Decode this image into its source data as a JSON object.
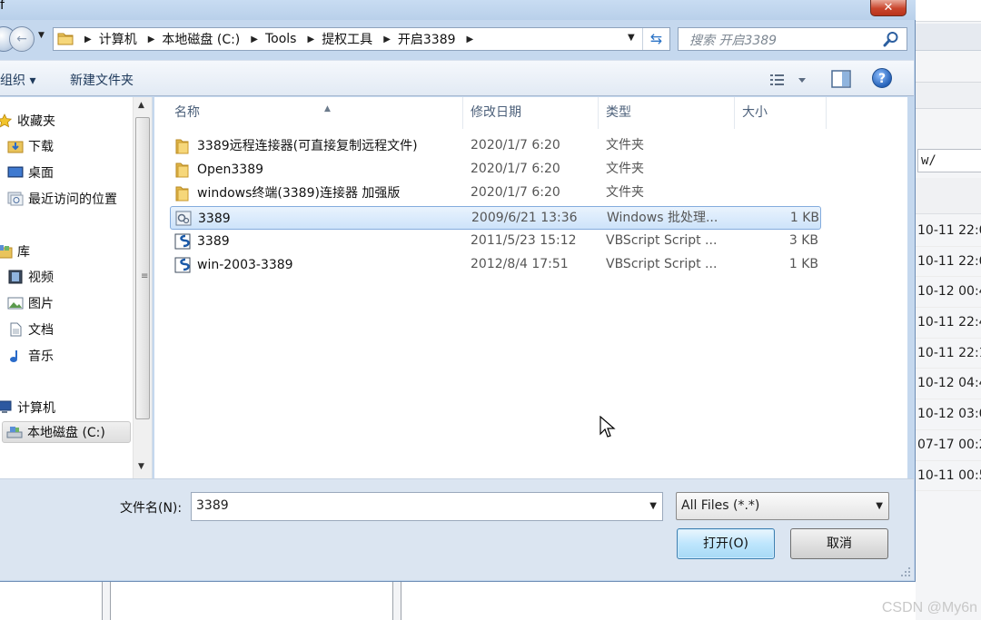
{
  "dialog": {
    "title_fragment": "f",
    "close_label": "✕"
  },
  "address": {
    "breadcrumbs": [
      "计算机",
      "本地磁盘 (C:)",
      "Tools",
      "提权工具",
      "开启3389"
    ]
  },
  "search": {
    "placeholder": "搜索 开启3389"
  },
  "toolbar": {
    "organize_label": "组织 ▾",
    "new_folder_label": "新建文件夹",
    "help_label": "?"
  },
  "navpane": {
    "favorites": "收藏夹",
    "downloads": "下载",
    "desktop": "桌面",
    "recent": "最近访问的位置",
    "libraries": "库",
    "videos": "视频",
    "pictures": "图片",
    "documents": "文档",
    "music": "音乐",
    "computer": "计算机",
    "local_disk": "本地磁盘 (C:)"
  },
  "filelist": {
    "columns": {
      "name": "名称",
      "date": "修改日期",
      "type": "类型",
      "size": "大小"
    },
    "rows": [
      {
        "name": "3389远程连接器(可直接复制远程文件)",
        "date": "2020/1/7 6:20",
        "type": "文件夹",
        "size": "",
        "icon": "folder-icon"
      },
      {
        "name": "Open3389",
        "date": "2020/1/7 6:20",
        "type": "文件夹",
        "size": "",
        "icon": "folder-icon"
      },
      {
        "name": "windows终端(3389)连接器 加强版",
        "date": "2020/1/7 6:20",
        "type": "文件夹",
        "size": "",
        "icon": "folder-icon"
      },
      {
        "name": "3389",
        "date": "2009/6/21 13:36",
        "type": "Windows 批处理...",
        "size": "1 KB",
        "icon": "batch-file-icon"
      },
      {
        "name": "3389",
        "date": "2011/5/23 15:12",
        "type": "VBScript Script ...",
        "size": "3 KB",
        "icon": "vbscript-file-icon"
      },
      {
        "name": "win-2003-3389",
        "date": "2012/8/4 17:51",
        "type": "VBScript Script ...",
        "size": "1 KB",
        "icon": "vbscript-file-icon"
      }
    ]
  },
  "footer": {
    "filename_label": "文件名(N):",
    "filename_value": "3389",
    "filetype_value": "All Files (*.*)",
    "open_label": "打开(O)",
    "cancel_label": "取消"
  },
  "background": {
    "path_fragment": "w/",
    "date_fragments": [
      "10-11 22:0",
      "10-11 22:0",
      "10-12 00:4",
      "10-11 22:4",
      "10-11 22:1",
      "10-12 04:4",
      "10-12 03:0",
      "07-17 00:2",
      "10-11 00:5"
    ],
    "watermark": "CSDN @My6n"
  },
  "colors": {
    "selection": "#cde3fa",
    "selection_border": "#84acdd",
    "toolbar_bg": "#e2eaf4",
    "footer_bg": "#dbe5f1",
    "accent_link": "#1e395b"
  }
}
